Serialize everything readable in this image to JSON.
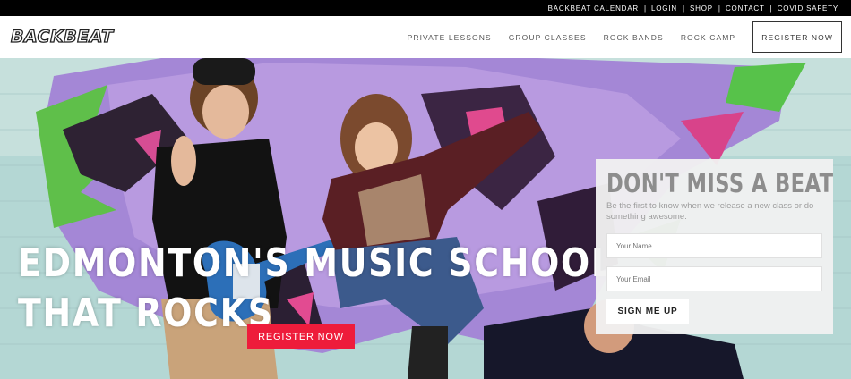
{
  "topbar": {
    "links": [
      "BACKBEAT CALENDAR",
      "LOGIN",
      "SHOP",
      "CONTACT",
      "COVID SAFETY"
    ]
  },
  "header": {
    "logo_text": "BACKBEAT",
    "nav": [
      "PRIVATE LESSONS",
      "GROUP CLASSES",
      "ROCK BANDS",
      "ROCK CAMP"
    ],
    "register_label": "REGISTER NOW"
  },
  "hero": {
    "headline_line1": "EDMONTON'S MUSIC SCHOOL",
    "headline_line2": "THAT ROCKS",
    "button_label": "REGISTER NOW",
    "button_color": "#ee1c3b"
  },
  "signup_form": {
    "title": "DON'T MISS A BEAT",
    "subtitle": "Be the first to know when we release a new class or do something awesome.",
    "name_placeholder": "Your Name",
    "email_placeholder": "Your Email",
    "submit_label": "SIGN ME UP"
  }
}
